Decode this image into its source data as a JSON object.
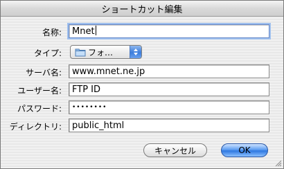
{
  "window": {
    "title": "ショートカット編集"
  },
  "fields": {
    "name": {
      "label": "名称:",
      "value": "Mnet"
    },
    "type": {
      "label": "タイプ:",
      "selected": "フォ…"
    },
    "server": {
      "label": "サーバ名:",
      "value": "www.mnet.ne.jp"
    },
    "username": {
      "label": "ユーザー名:",
      "value": "FTP ID"
    },
    "password": {
      "label": "パスワード:",
      "value": "••••••••"
    },
    "directory": {
      "label": "ディレクトリ:",
      "value": "public_html"
    }
  },
  "buttons": {
    "cancel": "キャンセル",
    "ok": "OK"
  },
  "colors": {
    "accent": "#3c7ddc",
    "focus_ring": "#9fc0ee"
  },
  "icons": {
    "type_popup": "folder-icon",
    "popup_arrows": "up-down-arrows-icon",
    "resize": "resize-grip-icon"
  }
}
